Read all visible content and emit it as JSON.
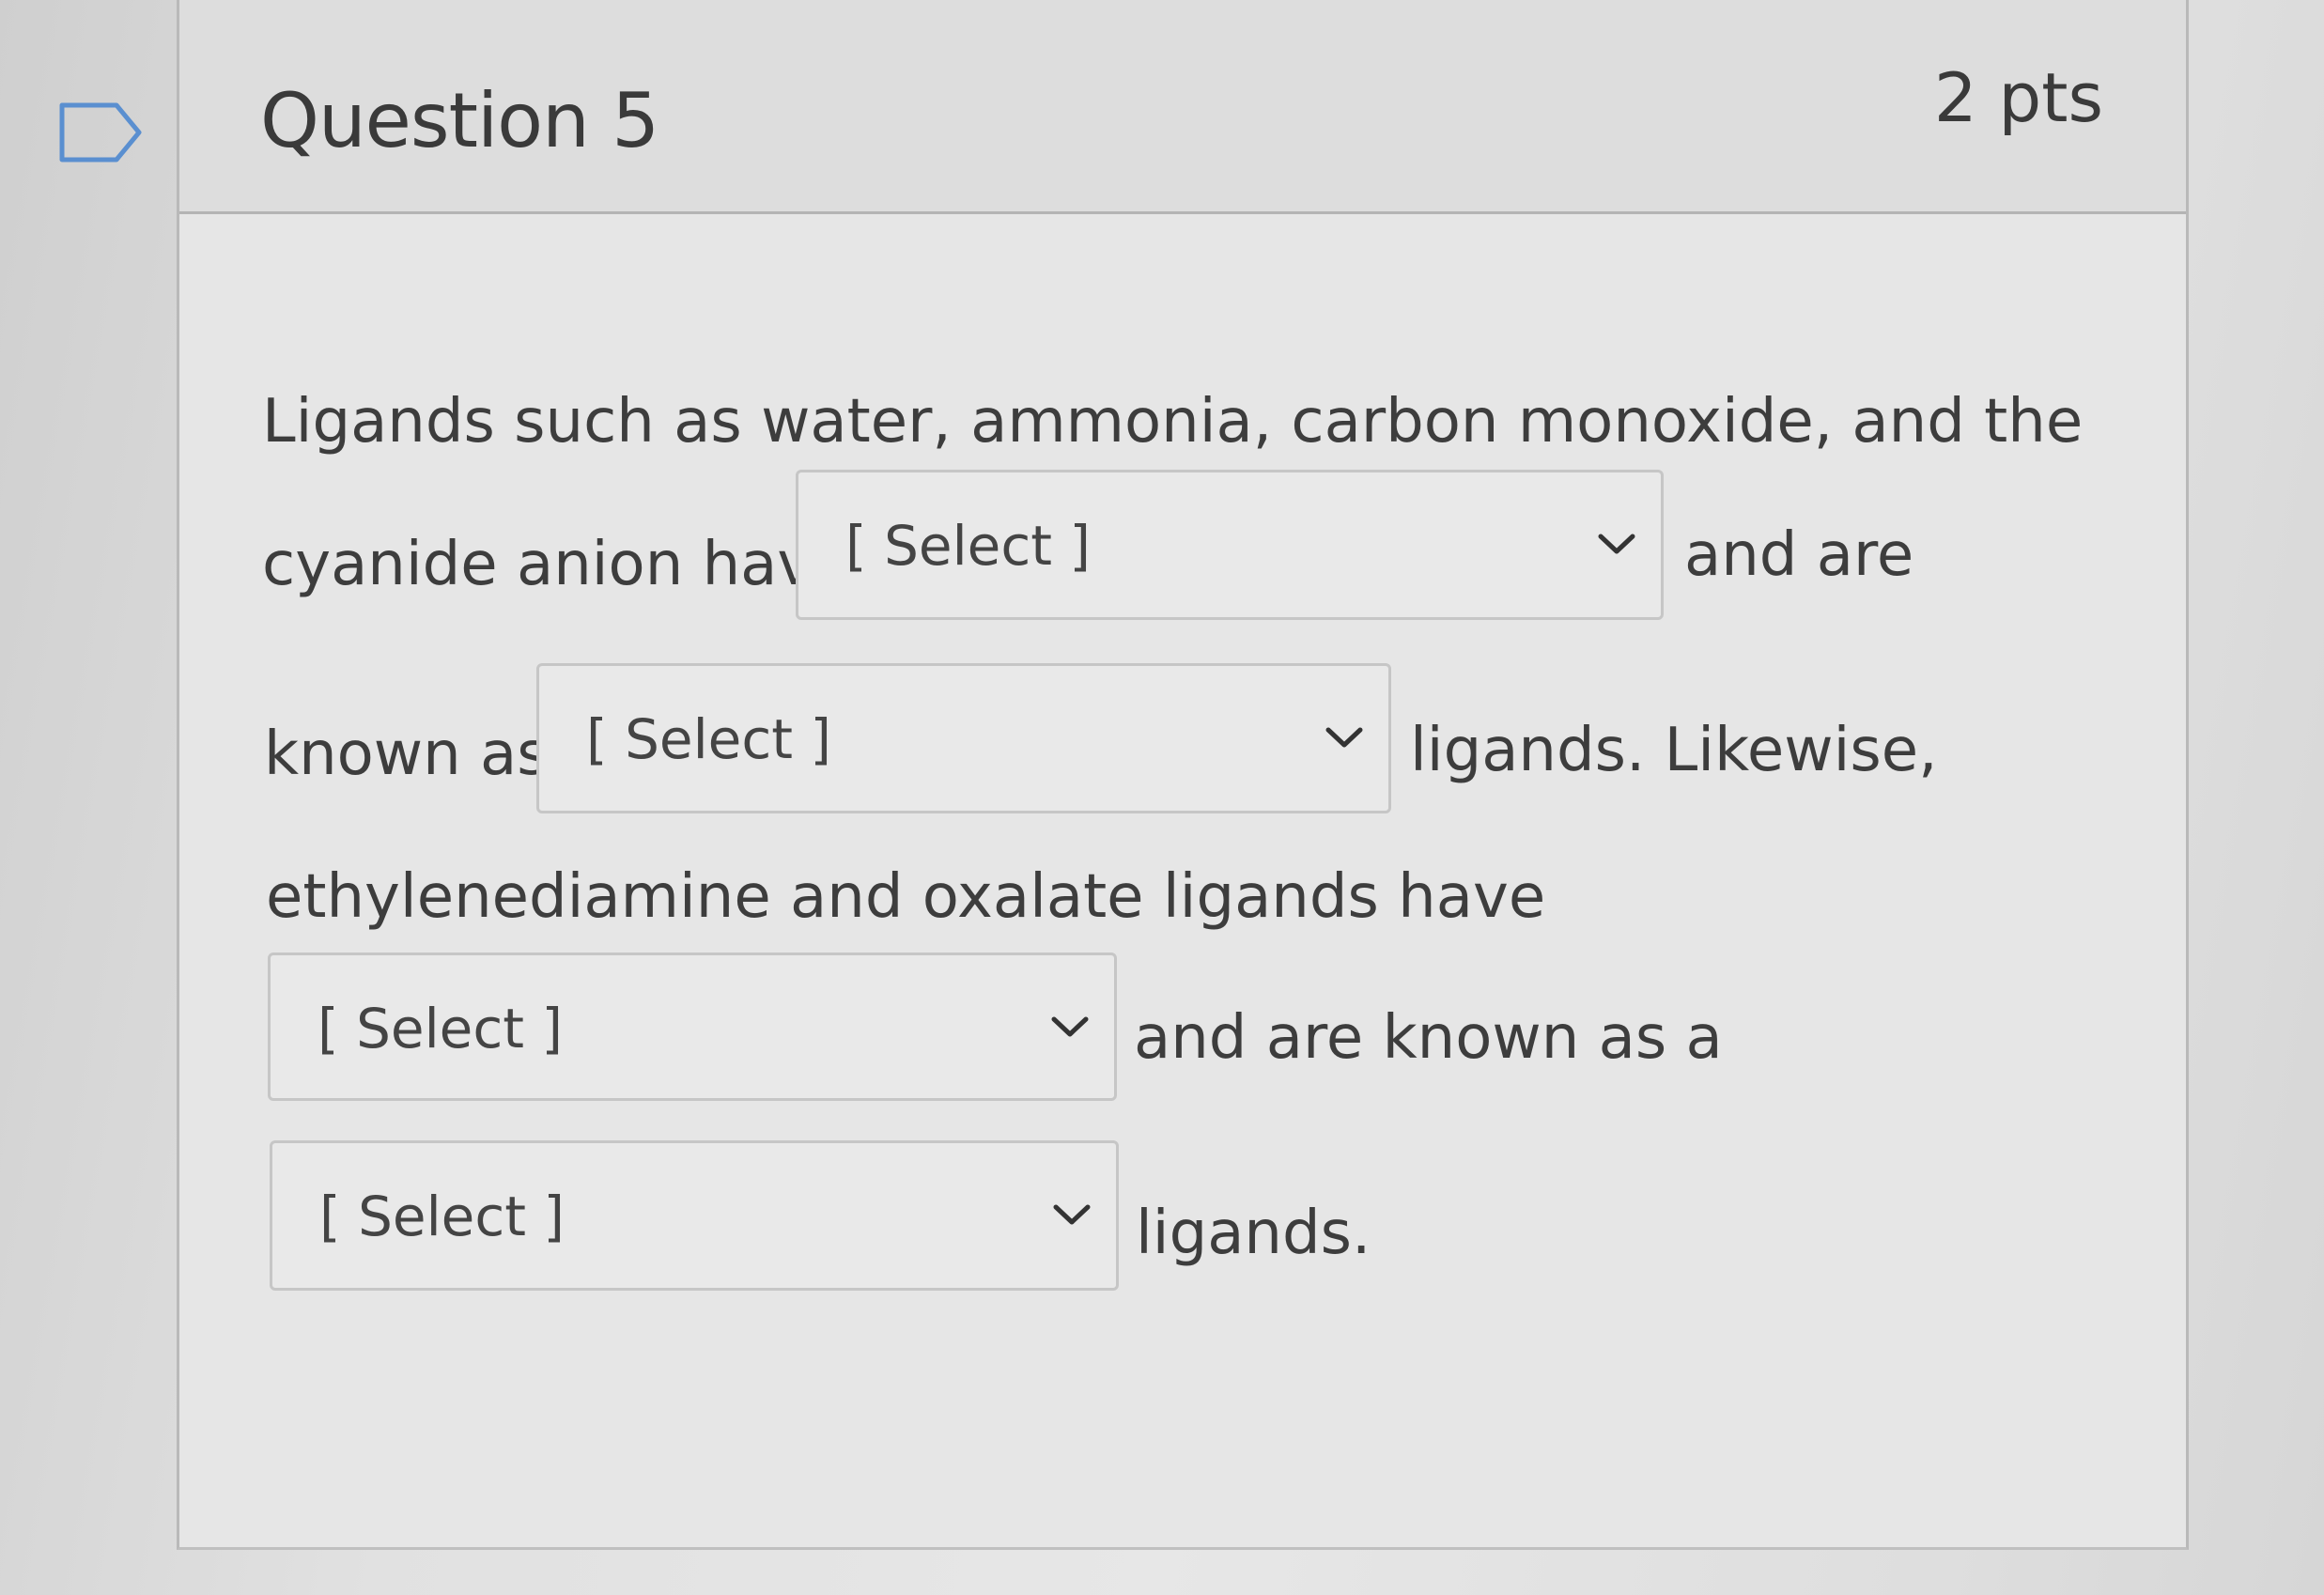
{
  "question": {
    "title": "Question 5",
    "points": "2 pts"
  },
  "body": {
    "line1": "Ligands such as water, ammonia, carbon monoxide, and the",
    "line2_before": "cyanide anion have",
    "line2_after": "and are",
    "line3_before": "known as",
    "line3_after": "ligands.  Likewise,",
    "line4": "ethylenediamine and oxalate ligands have",
    "line5_after": "and are known as a",
    "line6_after": "ligands."
  },
  "selects": [
    {
      "value": "[ Select ]"
    },
    {
      "value": "[ Select ]"
    },
    {
      "value": "[ Select ]"
    },
    {
      "value": "[ Select ]"
    }
  ],
  "icons": {
    "flag": "flag-outline-icon",
    "dropdown": "chevron-down-icon"
  },
  "colors": {
    "text": "#3d3d3d",
    "header_bg": "#dddddd",
    "border": "#c6c6c6"
  }
}
